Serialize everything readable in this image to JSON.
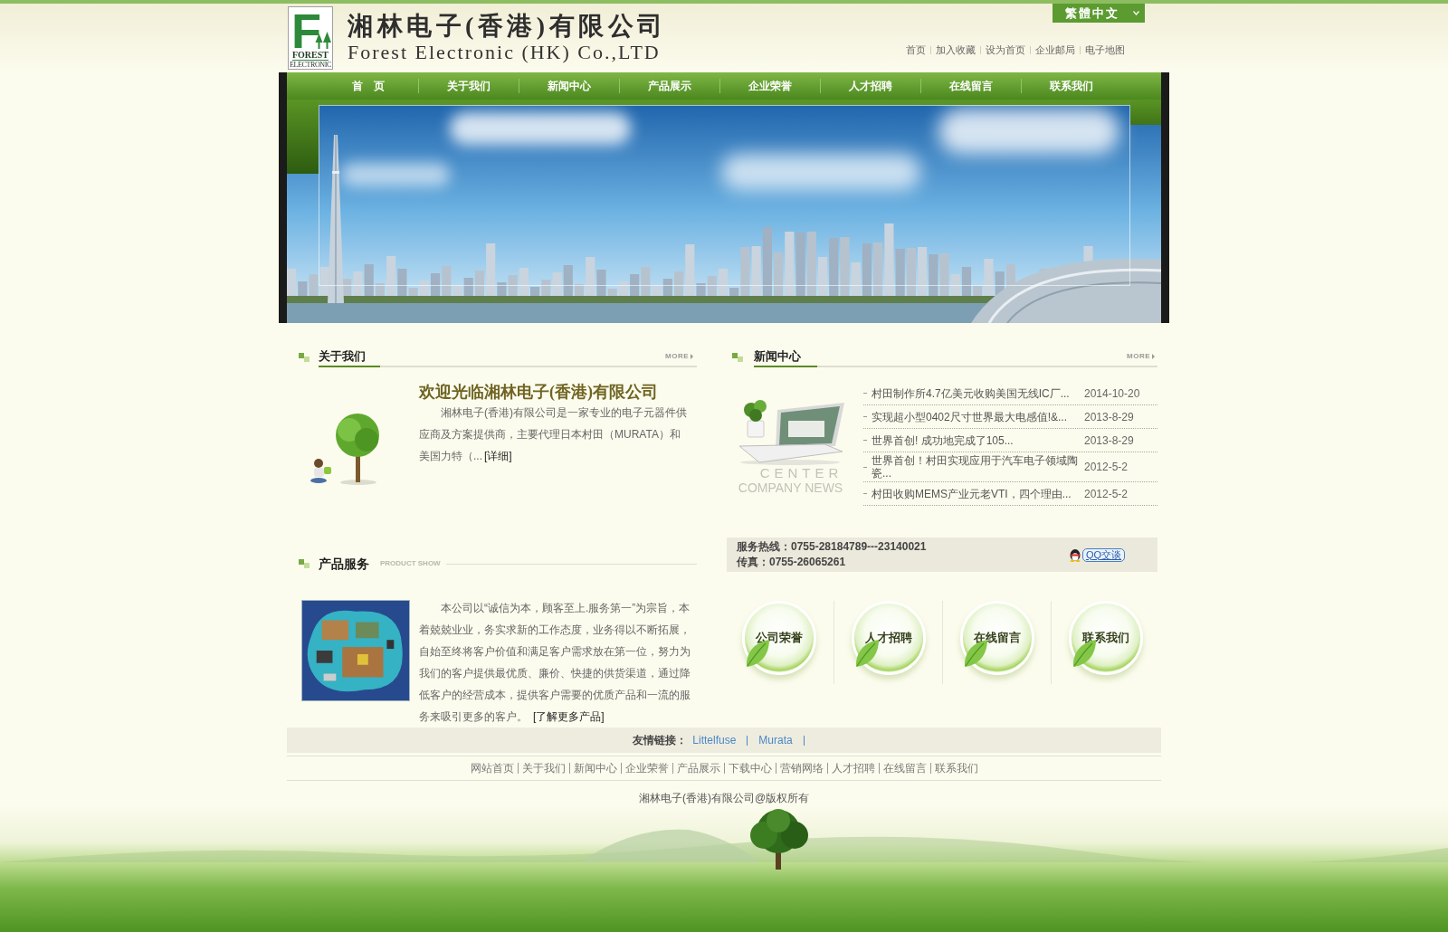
{
  "header": {
    "logo": {
      "mark": "F",
      "name": "FOREST",
      "subtitle": "ELECTRONIC"
    },
    "company_name": "湘林电子(香港)有限公司",
    "company_name_en": "Forest Electronic (HK) Co.,LTD",
    "language": "繁體中文",
    "top_links": [
      "首页",
      "加入收藏",
      "设为首页",
      "企业邮局",
      "电子地图"
    ]
  },
  "nav": [
    "首　页",
    "关于我们",
    "新闻中心",
    "产品展示",
    "企业荣誉",
    "人才招聘",
    "在线留言",
    "联系我们"
  ],
  "about": {
    "title": "关于我们",
    "more": "MORE",
    "heading": "欢迎光临湘林电子(香港)有限公司",
    "text": "湘林电子(香港)有限公司是一家专业的电子元器件供应商及方案提供商，主要代理日本村田（MURATA）和美国力特（...",
    "link": "[详细]"
  },
  "news": {
    "title": "新闻中心",
    "more": "MORE",
    "image_caption": [
      "CENTER",
      "COMPANY NEWS"
    ],
    "items": [
      {
        "title": "村田制作所4.7亿美元收购美国无线IC厂...",
        "date": "2014-10-20"
      },
      {
        "title": "实现超小型0402尺寸世界最大电感值!&...",
        "date": "2013-8-29"
      },
      {
        "title": "世界首创! 成功地完成了105...",
        "date": "2013-8-29"
      },
      {
        "title": "世界首创！村田实现应用于汽车电子领域陶瓷...",
        "date": "2012-5-2"
      },
      {
        "title": "村田收购MEMS产业元老VTI，四个理由...",
        "date": "2012-5-2"
      }
    ]
  },
  "products": {
    "title": "产品服务",
    "subtitle": "PRODUCT SHOW",
    "text": "本公司以“诚信为本，顾客至上.服务第一”为宗旨，本着兢兢业业，务实求新的工作态度，业务得以不断拓展，自始至终将客户价值和满足客户需求放在第一位，努力为我们的客户提供最优质、廉价、快捷的供货渠道，通过降低客户的经营成本，提供客户需要的优质产品和一流的服务来吸引更多的客户。",
    "link": "[了解更多产品]"
  },
  "contact": {
    "lines": [
      "服务热线：0755-28184789---23140021",
      "传真：0755-26065261"
    ],
    "qq_button": "QQ交谈"
  },
  "quick_links": [
    "公司荣誉",
    "人才招聘",
    "在线留言",
    "联系我们"
  ],
  "friend_links": {
    "label": "友情链接：",
    "links": [
      "Littelfuse",
      "Murata"
    ]
  },
  "footer": {
    "links": [
      "网站首页",
      "关于我们",
      "新闻中心",
      "企业荣誉",
      "产品展示",
      "下载中心",
      "营销网络",
      "人才招聘",
      "在线留言",
      "联系我们"
    ],
    "copyright": "湘林电子(香港)有限公司@版权所有"
  }
}
